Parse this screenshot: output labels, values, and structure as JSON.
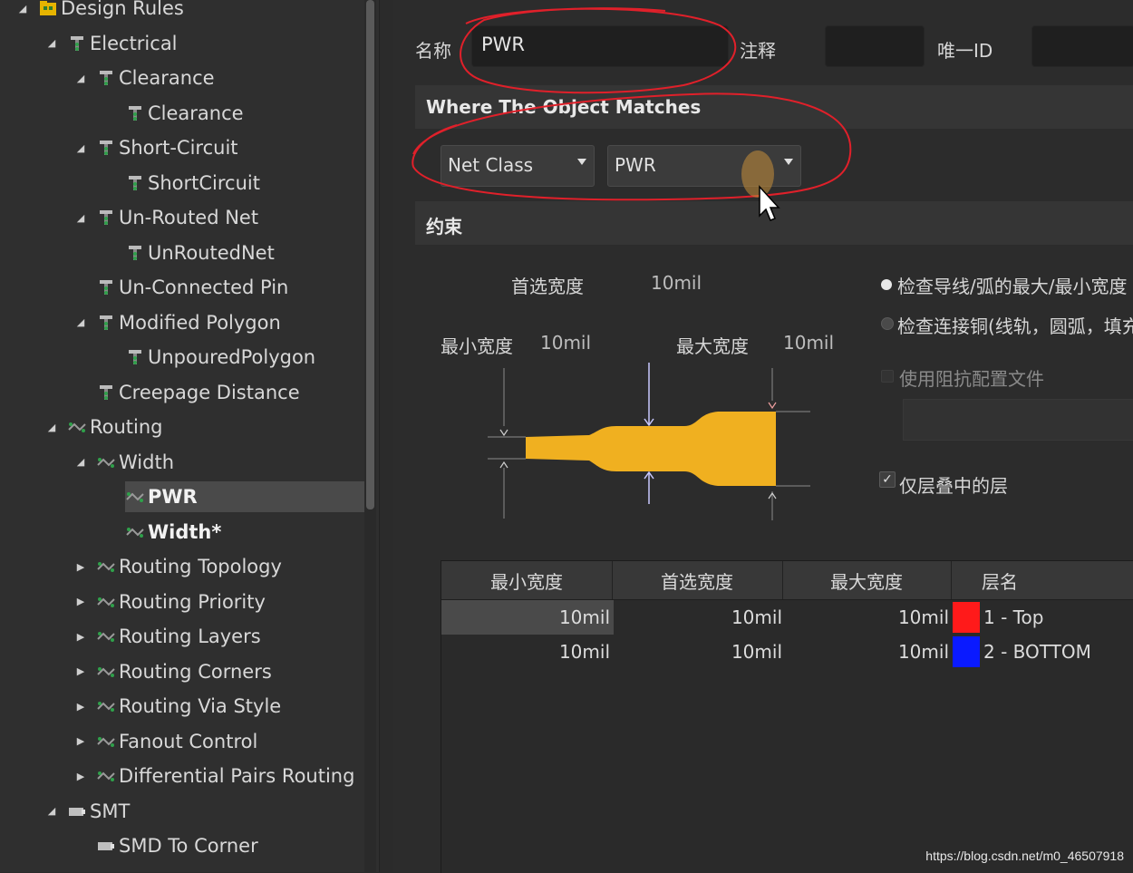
{
  "tree": {
    "items": [
      {
        "label": "Design Rules",
        "depth": 0,
        "expand": "open",
        "icon": "rules-folder-icon"
      },
      {
        "label": "Electrical",
        "depth": 1,
        "expand": "open",
        "icon": "electrical-rule-icon"
      },
      {
        "label": "Clearance",
        "depth": 2,
        "expand": "open",
        "icon": "electrical-rule-icon"
      },
      {
        "label": "Clearance",
        "depth": 3,
        "expand": "none",
        "icon": "electrical-rule-icon"
      },
      {
        "label": "Short-Circuit",
        "depth": 2,
        "expand": "open",
        "icon": "electrical-rule-icon"
      },
      {
        "label": "ShortCircuit",
        "depth": 3,
        "expand": "none",
        "icon": "electrical-rule-icon"
      },
      {
        "label": "Un-Routed Net",
        "depth": 2,
        "expand": "open",
        "icon": "electrical-rule-icon"
      },
      {
        "label": "UnRoutedNet",
        "depth": 3,
        "expand": "none",
        "icon": "electrical-rule-icon"
      },
      {
        "label": "Un-Connected Pin",
        "depth": 2,
        "expand": "none",
        "icon": "electrical-rule-icon"
      },
      {
        "label": "Modified Polygon",
        "depth": 2,
        "expand": "open",
        "icon": "electrical-rule-icon"
      },
      {
        "label": "UnpouredPolygon",
        "depth": 3,
        "expand": "none",
        "icon": "electrical-rule-icon"
      },
      {
        "label": "Creepage Distance",
        "depth": 2,
        "expand": "none",
        "icon": "electrical-rule-icon"
      },
      {
        "label": "Routing",
        "depth": 1,
        "expand": "open",
        "icon": "routing-rule-icon"
      },
      {
        "label": "Width",
        "depth": 2,
        "expand": "open",
        "icon": "routing-rule-icon"
      },
      {
        "label": "PWR",
        "depth": 3,
        "expand": "none",
        "icon": "routing-rule-icon",
        "selected": true,
        "bold": true
      },
      {
        "label": "Width*",
        "depth": 3,
        "expand": "none",
        "icon": "routing-rule-icon",
        "bold": true
      },
      {
        "label": "Routing Topology",
        "depth": 2,
        "expand": "closed",
        "icon": "routing-rule-icon"
      },
      {
        "label": "Routing Priority",
        "depth": 2,
        "expand": "closed",
        "icon": "routing-rule-icon"
      },
      {
        "label": "Routing Layers",
        "depth": 2,
        "expand": "closed",
        "icon": "routing-rule-icon"
      },
      {
        "label": "Routing Corners",
        "depth": 2,
        "expand": "closed",
        "icon": "routing-rule-icon"
      },
      {
        "label": "Routing Via Style",
        "depth": 2,
        "expand": "closed",
        "icon": "routing-rule-icon"
      },
      {
        "label": "Fanout Control",
        "depth": 2,
        "expand": "closed",
        "icon": "routing-rule-icon"
      },
      {
        "label": "Differential Pairs Routing",
        "depth": 2,
        "expand": "closed",
        "icon": "routing-rule-icon"
      },
      {
        "label": "SMT",
        "depth": 1,
        "expand": "open",
        "icon": "smt-rule-icon"
      },
      {
        "label": "SMD To Corner",
        "depth": 2,
        "expand": "none",
        "icon": "smt-rule-icon"
      }
    ]
  },
  "header": {
    "name_label": "名称",
    "name_value": "PWR",
    "comment_label": "注释",
    "comment_value": "",
    "uid_label": "唯一ID",
    "uid_value": ""
  },
  "match": {
    "title": "Where The Object Matches",
    "type_value": "Net Class",
    "target_value": "PWR"
  },
  "constraints": {
    "title": "约束",
    "preferred_label": "首选宽度",
    "preferred_value": "10mil",
    "min_label": "最小宽度",
    "min_value": "10mil",
    "max_label": "最大宽度",
    "max_value": "10mil",
    "opt_check_track": "检查导线/弧的最大/最小宽度",
    "opt_check_copper": "检查连接铜(线轨，圆弧，填充，",
    "opt_impedance": "使用阻抗配置文件",
    "opt_stack_only": "仅层叠中的层",
    "check_mark": "✓",
    "trace_color": "#f0b020"
  },
  "table": {
    "headers": [
      "最小宽度",
      "首选宽度",
      "最大宽度",
      "层名"
    ],
    "rows": [
      {
        "min": "10mil",
        "pref": "10mil",
        "max": "10mil",
        "color": "#ff1a1a",
        "layer": "1 - Top"
      },
      {
        "min": "10mil",
        "pref": "10mil",
        "max": "10mil",
        "color": "#0a1aff",
        "layer": "2 - BOTTOM"
      }
    ]
  },
  "watermark": "https://blog.csdn.net/m0_46507918",
  "annotations": {
    "color": "#e0202a"
  }
}
